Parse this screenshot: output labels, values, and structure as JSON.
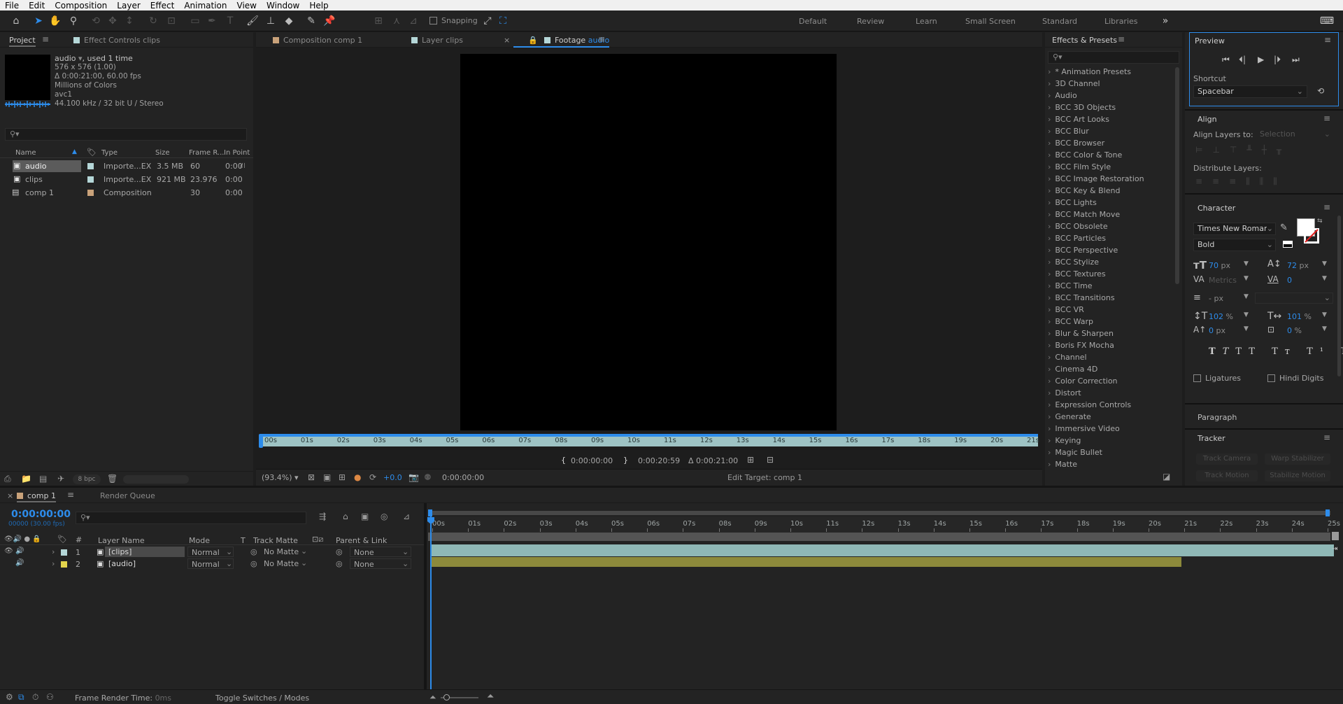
{
  "menu": [
    "File",
    "Edit",
    "Composition",
    "Layer",
    "Effect",
    "Animation",
    "View",
    "Window",
    "Help"
  ],
  "toolbar": {
    "snapping_label": "Snapping",
    "workspaces": [
      "Default",
      "Review",
      "Learn",
      "Small Screen",
      "Standard",
      "Libraries"
    ]
  },
  "project": {
    "tabs": [
      "Project",
      "Effect Controls clips"
    ],
    "item_name": "audio",
    "item_used": ", used 1 time",
    "info": [
      "576 x 576 (1.00)",
      "Δ 0:00:21:00, 60.00 fps",
      "Millions of Colors",
      "avc1",
      "44.100 kHz / 32 bit U / Stereo"
    ],
    "columns": [
      "Name",
      "Type",
      "Size",
      "Frame R...",
      "In Point"
    ],
    "items": [
      {
        "name": "audio",
        "color": "#b5d7d8",
        "type": "Importe...EX",
        "size": "3.5 MB",
        "frame_rate": "60",
        "in_point": "0:00",
        "selected": true
      },
      {
        "name": "clips",
        "color": "#b5d7d8",
        "type": "Importe...EX",
        "size": "921 MB",
        "frame_rate": "23.976",
        "in_point": "0:00",
        "selected": false
      },
      {
        "name": "comp 1",
        "color": "#c9a27a",
        "type": "Composition",
        "size": "",
        "frame_rate": "30",
        "in_point": "0:00",
        "selected": false
      }
    ],
    "bpc": "8 bpc"
  },
  "viewer": {
    "tabs": [
      "Composition comp 1",
      "Layer clips",
      "Footage audio"
    ],
    "footage_prefix": "Footage",
    "footage_name": "audio",
    "ruler_ticks": [
      "00s",
      "01s",
      "02s",
      "03s",
      "04s",
      "05s",
      "06s",
      "07s",
      "08s",
      "09s",
      "10s",
      "11s",
      "12s",
      "13s",
      "14s",
      "15s",
      "16s",
      "17s",
      "18s",
      "19s",
      "20s",
      "21s"
    ],
    "in_time": "0:00:00:00",
    "out_time": "0:00:20:59",
    "duration": "Δ 0:00:21:00",
    "zoom": "(93.4%)",
    "exposure": "+0.0",
    "current_time": "0:00:00:00",
    "edit_target": "Edit Target: comp 1"
  },
  "effects": {
    "title": "Effects & Presets",
    "items": [
      "* Animation Presets",
      "3D Channel",
      "Audio",
      "BCC 3D Objects",
      "BCC Art Looks",
      "BCC Blur",
      "BCC Browser",
      "BCC Color & Tone",
      "BCC Film Style",
      "BCC Image Restoration",
      "BCC Key & Blend",
      "BCC Lights",
      "BCC Match Move",
      "BCC Obsolete",
      "BCC Particles",
      "BCC Perspective",
      "BCC Stylize",
      "BCC Textures",
      "BCC Time",
      "BCC Transitions",
      "BCC VR",
      "BCC Warp",
      "Blur & Sharpen",
      "Boris FX Mocha",
      "Channel",
      "Cinema 4D",
      "Color Correction",
      "Distort",
      "Expression Controls",
      "Generate",
      "Immersive Video",
      "Keying",
      "Magic Bullet",
      "Matte"
    ]
  },
  "preview": {
    "title": "Preview",
    "shortcut_label": "Shortcut",
    "shortcut_value": "Spacebar"
  },
  "align": {
    "title": "Align",
    "layers_to_label": "Align Layers to:",
    "layers_to_value": "Selection",
    "distribute_label": "Distribute Layers:"
  },
  "character": {
    "title": "Character",
    "font": "Times New Roman",
    "style": "Bold",
    "font_size": "70",
    "font_size_unit": "px",
    "leading": "72",
    "leading_unit": "px",
    "kerning": "Metrics",
    "tracking": "0",
    "stroke": "- px",
    "vscale": "102",
    "vscale_unit": "%",
    "hscale": "101",
    "hscale_unit": "%",
    "baseline": "0",
    "baseline_unit": "px",
    "tsume": "0",
    "tsume_unit": "%",
    "ligatures": "Ligatures",
    "hindi_digits": "Hindi Digits",
    "fill_color": "#ffffff"
  },
  "paragraph": {
    "title": "Paragraph"
  },
  "tracker": {
    "title": "Tracker",
    "buttons": [
      "Track Camera",
      "Warp Stabilizer",
      "Track Motion",
      "Stabilize Motion"
    ]
  },
  "timeline": {
    "tabs": [
      "comp 1",
      "Render Queue"
    ],
    "timecode": "0:00:00:00",
    "frames": "00000 (30.00 fps)",
    "columns": {
      "layer_name": "Layer Name",
      "mode": "Mode",
      "t": "T",
      "track_matte": "Track Matte",
      "parent": "Parent & Link"
    },
    "layers": [
      {
        "num": "1",
        "name": "[clips]",
        "color": "#b5d7d8",
        "mode": "Normal",
        "matte": "No Matte",
        "parent": "None",
        "bar_color": "#8fb8b6",
        "bar_end_pct": 100
      },
      {
        "num": "2",
        "name": "[audio]",
        "color": "#e3d44c",
        "mode": "Normal",
        "matte": "No Matte",
        "parent": "None",
        "bar_color": "#8d8a3b",
        "bar_end_pct": 84
      }
    ],
    "ruler_ticks": [
      "00s",
      "01s",
      "02s",
      "03s",
      "04s",
      "05s",
      "06s",
      "07s",
      "08s",
      "09s",
      "10s",
      "11s",
      "12s",
      "13s",
      "14s",
      "15s",
      "16s",
      "17s",
      "18s",
      "19s",
      "20s",
      "21s",
      "22s",
      "23s",
      "24s",
      "25s"
    ],
    "frame_render_label": "Frame Render Time:",
    "frame_render_value": "0ms",
    "toggle_label": "Toggle Switches / Modes"
  }
}
